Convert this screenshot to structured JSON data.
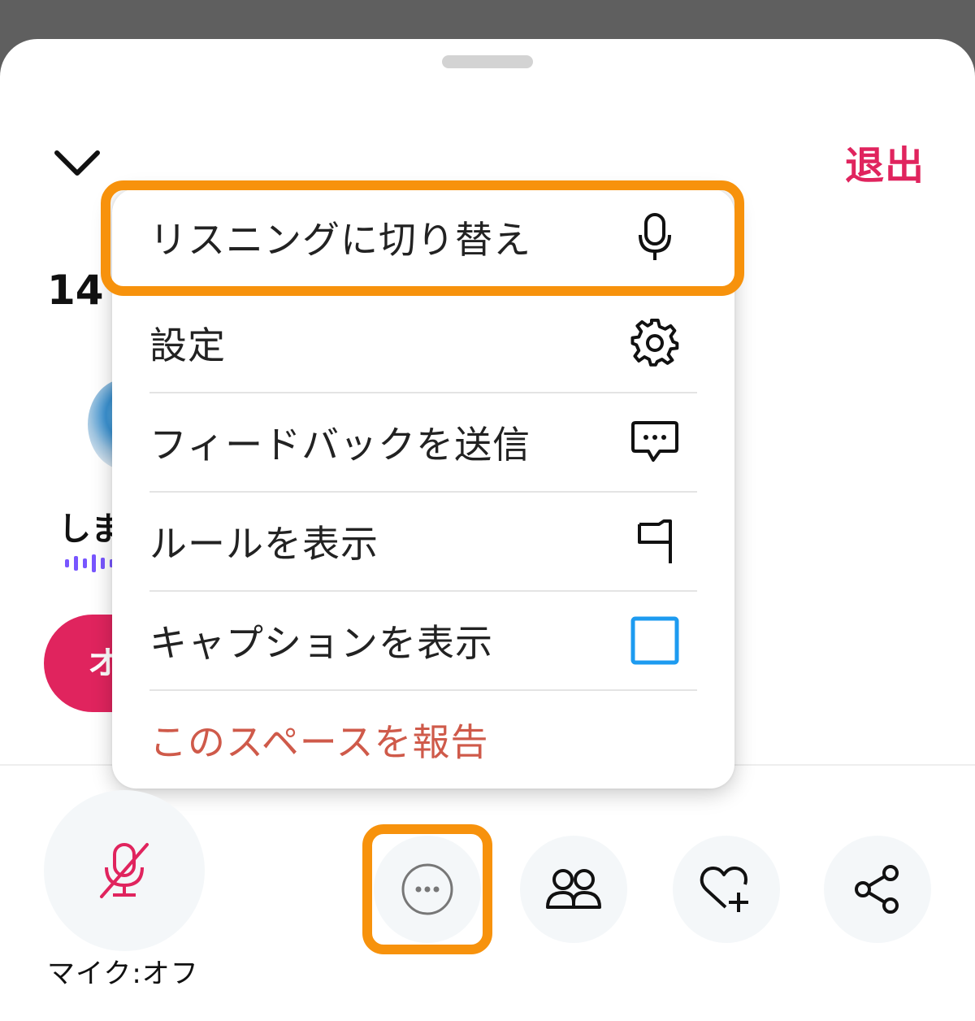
{
  "header": {
    "leave_label": "退出",
    "collapse_icon": "chevron-down-icon"
  },
  "background_space": {
    "count_partial": "14",
    "speaker_name_partial": "しま",
    "button_partial": "オ"
  },
  "menu": {
    "items": [
      {
        "label": "リスニングに切り替え",
        "icon": "microphone-icon",
        "highlighted": true
      },
      {
        "label": "設定",
        "icon": "gear-icon"
      },
      {
        "label": "フィードバックを送信",
        "icon": "feedback-message-icon"
      },
      {
        "label": "ルールを表示",
        "icon": "flag-icon"
      },
      {
        "label": "キャプションを表示",
        "icon": "checkbox-unchecked"
      },
      {
        "label": "このスペースを報告",
        "icon": "",
        "color": "#cf5a4a"
      }
    ]
  },
  "bottom_bar": {
    "mic_label": "マイク:オフ",
    "buttons": [
      "more-icon",
      "people-icon",
      "heart-plus-icon",
      "share-icon"
    ]
  },
  "colors": {
    "accent_pink": "#e0245e",
    "highlight_orange": "#f7920c",
    "checkbox_blue": "#1d9bf0",
    "report_red": "#cf5a4a"
  }
}
